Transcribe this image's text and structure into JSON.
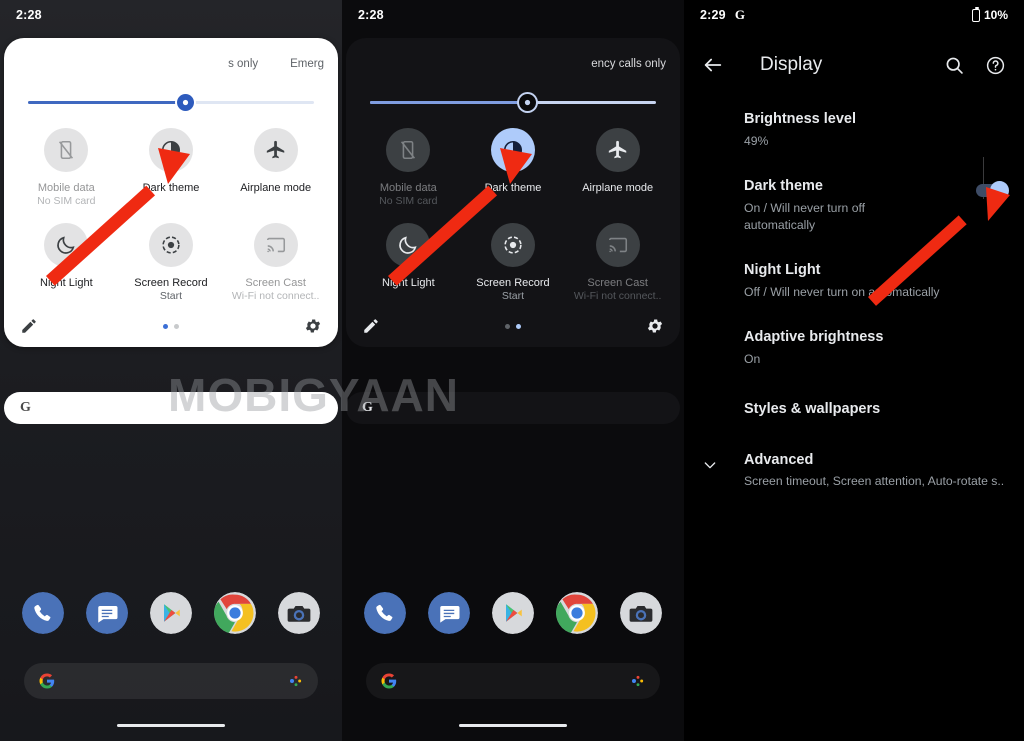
{
  "watermark": "MOBIGYAAN",
  "panels": [
    {
      "id": "quick-settings-light",
      "statusbar": {
        "time": "2:28",
        "google": "",
        "battery": ""
      },
      "shade": {
        "carrier_left": "s only",
        "carrier_right": "Emerg",
        "brightness_percent": 55,
        "tiles": [
          {
            "label": "Mobile data",
            "sub": "No SIM card",
            "icon": "mobile-data-off-icon",
            "state": "off",
            "dim": true
          },
          {
            "label": "Dark theme",
            "sub": "",
            "icon": "dark-theme-icon",
            "state": "off",
            "dim": false
          },
          {
            "label": "Airplane mode",
            "sub": "",
            "icon": "airplane-icon",
            "state": "off",
            "dim": false
          },
          {
            "label": "Night Light",
            "sub": "",
            "icon": "night-light-icon",
            "state": "off",
            "dim": false
          },
          {
            "label": "Screen Record",
            "sub": "Start",
            "icon": "screen-record-icon",
            "state": "off",
            "dim": false
          },
          {
            "label": "Screen Cast",
            "sub": "Wi-Fi not connect..",
            "icon": "screen-cast-icon",
            "state": "off",
            "dim": true
          }
        ],
        "edit_icon": "pencil-icon",
        "settings_icon": "gear-icon",
        "page_dots": 2,
        "active_dot": 1
      },
      "search_placeholder": "G"
    },
    {
      "id": "quick-settings-dark",
      "statusbar": {
        "time": "2:28",
        "google": "",
        "battery": ""
      },
      "shade": {
        "carrier_left": "",
        "carrier_right": "ency calls only",
        "brightness_percent": 55,
        "tiles": [
          {
            "label": "Mobile data",
            "sub": "No SIM card",
            "icon": "mobile-data-off-icon",
            "state": "off",
            "dim": true
          },
          {
            "label": "Dark theme",
            "sub": "",
            "icon": "dark-theme-icon",
            "state": "on",
            "dim": false
          },
          {
            "label": "Airplane mode",
            "sub": "",
            "icon": "airplane-icon",
            "state": "off",
            "dim": false
          },
          {
            "label": "Night Light",
            "sub": "",
            "icon": "night-light-icon",
            "state": "off",
            "dim": false
          },
          {
            "label": "Screen Record",
            "sub": "Start",
            "icon": "screen-record-icon",
            "state": "off",
            "dim": false
          },
          {
            "label": "Screen Cast",
            "sub": "Wi-Fi not connect..",
            "icon": "screen-cast-icon",
            "state": "off",
            "dim": true
          }
        ],
        "edit_icon": "pencil-icon",
        "settings_icon": "gear-icon",
        "page_dots": 2,
        "active_dot": 2
      },
      "search_placeholder": "G"
    }
  ],
  "display_settings": {
    "statusbar": {
      "time": "2:29",
      "google": "G",
      "battery": "10%"
    },
    "appbar": {
      "back_icon": "back-arrow-icon",
      "title": "Display",
      "search_icon": "search-icon",
      "help_icon": "help-icon"
    },
    "rows": [
      {
        "title": "Brightness level",
        "sub": "49%",
        "toggle": null,
        "chevron": false
      },
      {
        "title": "Dark theme",
        "sub": "On / Will never turn off automatically",
        "toggle": "on",
        "chevron": false
      },
      {
        "title": "Night Light",
        "sub": "Off / Will never turn on automatically",
        "toggle": null,
        "chevron": false
      },
      {
        "title": "Adaptive brightness",
        "sub": "On",
        "toggle": null,
        "chevron": false
      },
      {
        "title": "Styles & wallpapers",
        "sub": "",
        "toggle": null,
        "chevron": false
      },
      {
        "title": "Advanced",
        "sub": "Screen timeout, Screen attention, Auto-rotate s..",
        "toggle": null,
        "chevron": true
      }
    ]
  },
  "dock": {
    "apps": [
      {
        "name": "phone-app-icon",
        "label": "Phone"
      },
      {
        "name": "messages-app-icon",
        "label": "Messages"
      },
      {
        "name": "play-store-app-icon",
        "label": "Play Store"
      },
      {
        "name": "chrome-app-icon",
        "label": "Chrome"
      },
      {
        "name": "camera-app-icon",
        "label": "Camera"
      }
    ],
    "search_icon": "google-g-icon",
    "mic_icon": "google-assistant-icon"
  },
  "annotations": {
    "arrow_color": "#ef2a12",
    "arrows": [
      {
        "target": "dark-theme-tile",
        "panel": 1
      },
      {
        "target": "dark-theme-tile",
        "panel": 2
      },
      {
        "target": "dark-theme-toggle",
        "panel": 3
      }
    ]
  },
  "colors": {
    "accent_blue": "#aecbfa",
    "slider_blue": "#2e5bbd",
    "bg_dark": "#000000",
    "shade_light": "#ffffff",
    "shade_dark": "#131316"
  }
}
